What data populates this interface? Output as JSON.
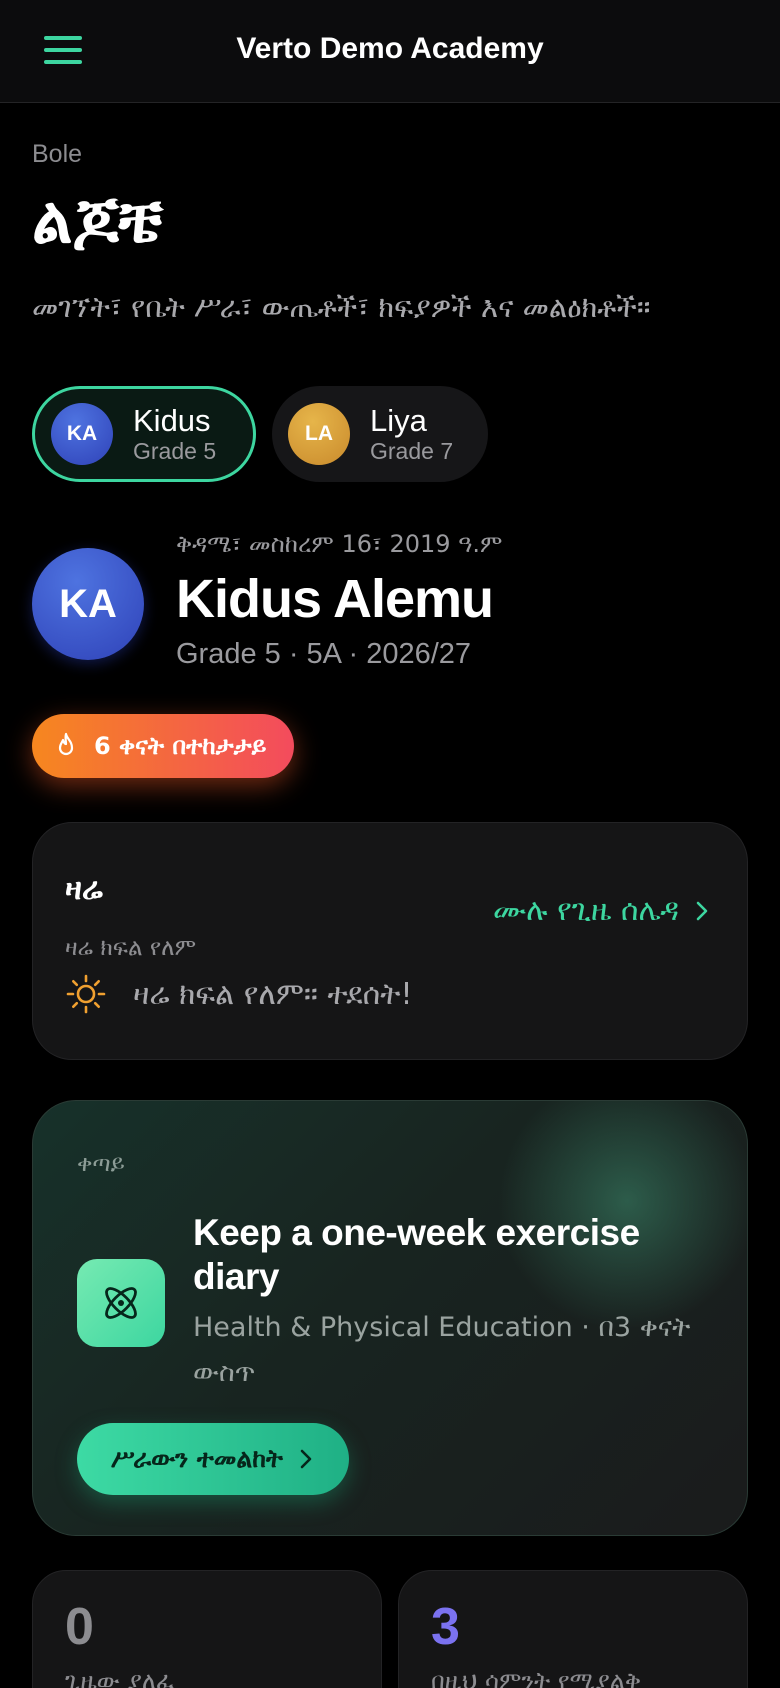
{
  "header": {
    "title": "Verto Demo Academy",
    "menu_icon": "hamburger-menu-icon"
  },
  "page": {
    "location": "Bole",
    "title": "ልጆቼ",
    "subtitle": "መገኘት፣ የቤት ሥራ፣ ውጤቶች፣ ክፍያዎች እና መልዕክቶች።"
  },
  "children": [
    {
      "initials": "KA",
      "name": "Kidus",
      "grade": "Grade 5",
      "selected": true,
      "color": "#3f5fd6"
    },
    {
      "initials": "LA",
      "name": "Liya",
      "grade": "Grade 7",
      "selected": false,
      "color": "#d9a43a"
    }
  ],
  "profile": {
    "initials": "KA",
    "date": "ቅዳሜ፣ መስከረም 16፣ 2019 ዓ.ም",
    "name": "Kidus Alemu",
    "meta": "Grade 5 · 5A · 2026/27"
  },
  "streak": {
    "label": "6 ቀናት በተከታታይ",
    "icon": "flame-icon"
  },
  "today": {
    "title": "ዛሬ",
    "link_label": "ሙሉ የጊዜ ሰሌዳ",
    "subtitle": "ዛሬ ክፍል የለም",
    "message": "ዛሬ ክፍል የለም። ተደሰት!",
    "icon": "sun-icon"
  },
  "next_task": {
    "label": "ቀጣይ",
    "title": "Keep a one-week exercise diary",
    "meta": "Health & Physical Education · በ3 ቀናት ውስጥ",
    "button_label": "ሥራውን ተመልከት",
    "icon": "atom-icon"
  },
  "stats": [
    {
      "value": "0",
      "label": "ጊዜው ያለፈ",
      "color": "#8c8c90"
    },
    {
      "value": "3",
      "label": "በዚህ ሳምንት የሚያልቅ",
      "color": "#7b72f0"
    }
  ],
  "colors": {
    "accent": "#3dd6a0",
    "background": "#000000",
    "streak_start": "#f6871f",
    "streak_end": "#f34b5d"
  }
}
